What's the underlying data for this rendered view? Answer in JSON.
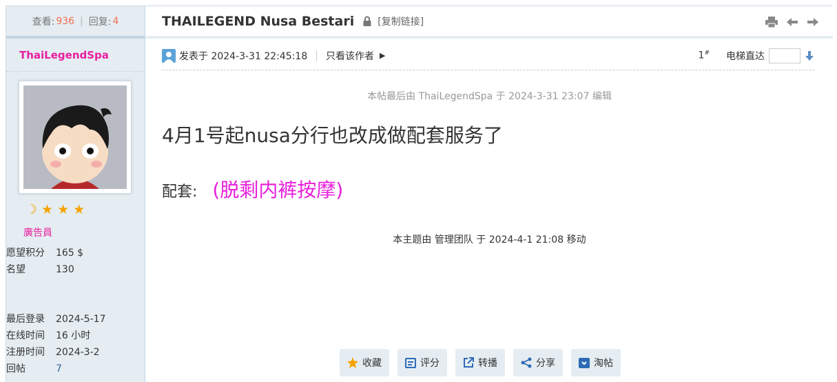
{
  "sidebar": {
    "views_label": "查看:",
    "views": "936",
    "sep": "|",
    "replies_label": "回复:",
    "replies": "4",
    "author": "ThaiLegendSpa",
    "rank": "廣告員",
    "stars_icons": [
      "moon-icon",
      "star-icon",
      "star-icon",
      "star-icon"
    ],
    "stats": [
      {
        "key": "愿望积分",
        "value": "165 $"
      },
      {
        "key": "名望",
        "value": "130"
      }
    ],
    "stats2": [
      {
        "key": "最后登录",
        "value": "2024-5-17"
      },
      {
        "key": "在线时间",
        "value": "16 小时"
      },
      {
        "key": "注册时间",
        "value": "2024-3-2"
      },
      {
        "key": "回帖",
        "value": "7"
      }
    ]
  },
  "thread": {
    "title": "THAILEGEND Nusa Bestari",
    "copy_link": "[复制链接]",
    "tools": [
      "print-icon",
      "prev-icon",
      "next-icon"
    ]
  },
  "post": {
    "posted_at": "发表于 2024-3-31 22:45:18",
    "meta_sep": "|",
    "only_author": "只看该作者",
    "floor": "1",
    "floor_mark": "#",
    "jump_label": "电梯直达",
    "edit_note": "本帖最后由 ThaiLegendSpa 于 2024-3-31 23:07 编辑",
    "line1": "4月1号起nusa分行也改成做配套服务了",
    "line2_label": "配套:",
    "line2_highlight": "(脱剩内裤按摩)",
    "moved_note": "本主题由 管理团队 于 2024-4-1 21:08 移动"
  },
  "actions": [
    {
      "label": "收藏",
      "icon": "star-icon"
    },
    {
      "label": "评分",
      "icon": "calendar-icon"
    },
    {
      "label": "转播",
      "icon": "share-out-icon"
    },
    {
      "label": "分享",
      "icon": "share-icon"
    },
    {
      "label": "淘帖",
      "icon": "box-icon"
    }
  ],
  "colors": {
    "accent": "#e91e9f",
    "highlight": "#e91edc",
    "number": "#f26c4f",
    "sidebar_bg": "#e5edf2"
  }
}
